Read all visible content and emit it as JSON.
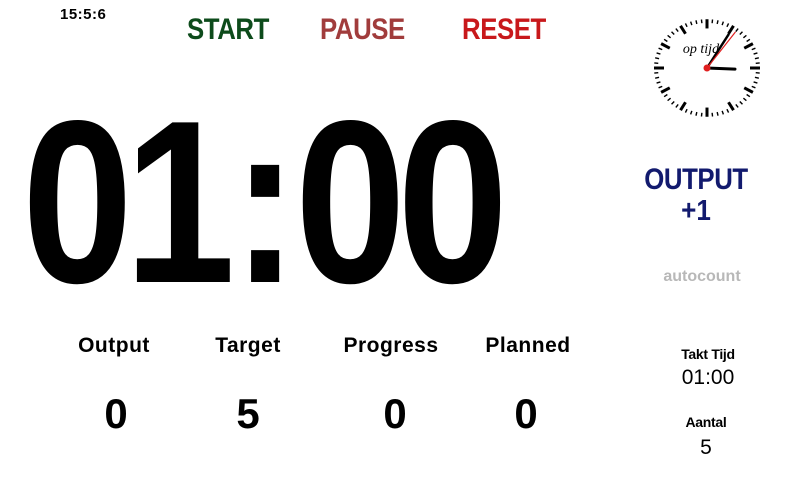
{
  "header": {
    "time_readout": "15:5:6"
  },
  "controls": {
    "start_label": "START",
    "pause_label": "PAUSE",
    "reset_label": "RESET",
    "colors": {
      "start": "#0d4b1b",
      "pause": "#a13c3c",
      "reset": "#c8181b"
    }
  },
  "analog_clock": {
    "brand_text": "op tijd",
    "hour": 15,
    "minute": 5,
    "second": 6,
    "second_hand_color": "#e02020"
  },
  "timer": {
    "minutes": "01",
    "separator": ":",
    "seconds": "00"
  },
  "output_button": {
    "title": "OUTPUT",
    "increment": "+1",
    "color": "#121a6e"
  },
  "autocount": {
    "label": "autocount",
    "color": "#b8b8b8"
  },
  "stats": [
    {
      "label": "Output",
      "value": "0"
    },
    {
      "label": "Target",
      "value": "5"
    },
    {
      "label": "Progress",
      "value": "0"
    },
    {
      "label": "Planned",
      "value": "0"
    }
  ],
  "side_info": {
    "takt_label": "Takt Tijd",
    "takt_value": "01:00",
    "aantal_label": "Aantal",
    "aantal_value": "5"
  }
}
